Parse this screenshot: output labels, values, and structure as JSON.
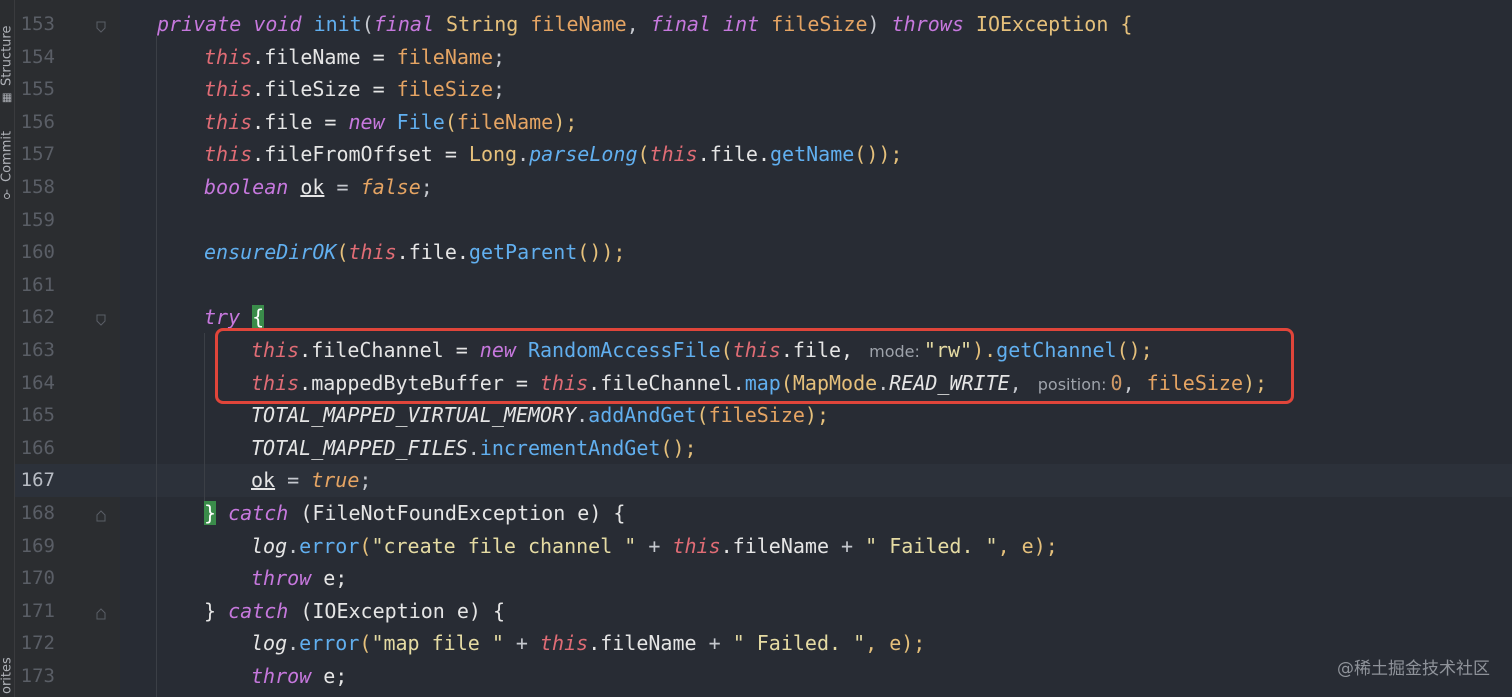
{
  "tool_windows": {
    "structure": "Structure",
    "commit": "Commit",
    "favorites": "orites"
  },
  "current_line": "167",
  "lines": [
    {
      "n": "153"
    },
    {
      "n": "154"
    },
    {
      "n": "155"
    },
    {
      "n": "156"
    },
    {
      "n": "157"
    },
    {
      "n": "158"
    },
    {
      "n": "159"
    },
    {
      "n": "160"
    },
    {
      "n": "161"
    },
    {
      "n": "162"
    },
    {
      "n": "163"
    },
    {
      "n": "164"
    },
    {
      "n": "165"
    },
    {
      "n": "166"
    },
    {
      "n": "167"
    },
    {
      "n": "168"
    },
    {
      "n": "169"
    },
    {
      "n": "170"
    },
    {
      "n": "171"
    },
    {
      "n": "172"
    },
    {
      "n": "173"
    }
  ],
  "code": {
    "l153": {
      "kw1": "private",
      "kw2": "void",
      "name": "init",
      "p1": "(",
      "kw3": "final",
      "t1": "String",
      "a1": "fileName",
      "c1": ", ",
      "kw4": "final",
      "kw5": "int",
      "a2": "fileSize",
      "p2": ") ",
      "kw6": "throws",
      "t2": "IOException",
      "p3": " {"
    },
    "l154": {
      "this": "this",
      "rest": ".fileName = ",
      "v": "fileName",
      "end": ";"
    },
    "l155": {
      "this": "this",
      "rest": ".fileSize = ",
      "v": "fileSize",
      "end": ";"
    },
    "l156": {
      "this": "this",
      "rest": ".file = ",
      "kw": "new",
      "cls": "File",
      "p1": "(",
      "v": "fileName",
      "end": ");"
    },
    "l157": {
      "this": "this",
      "rest": ".fileFromOffset = ",
      "cls": "Long",
      "dot": ".",
      "m": "parseLong",
      "p1": "(",
      "this2": "this",
      "mid": ".file.",
      "m2": "getName",
      "end": "());"
    },
    "l158": {
      "kw": "boolean",
      "var": "ok",
      "eq": " = ",
      "val": "false",
      "end": ";"
    },
    "l160": {
      "m": "ensureDirOK",
      "p1": "(",
      "this": "this",
      "mid": ".file.",
      "m2": "getParent",
      "end": "());"
    },
    "l162": {
      "kw": "try",
      "brace": "{"
    },
    "l163": {
      "this": "this",
      "rest": ".fileChannel = ",
      "kw": "new",
      "cls": "RandomAccessFile",
      "p1": "(",
      "this2": "this",
      "mid": ".file,",
      "hint": "mode:",
      "str": "\"rw\"",
      "p2": ").",
      "m": "getChannel",
      "end": "();"
    },
    "l164": {
      "this": "this",
      "rest": ".mappedByteBuffer = ",
      "this2": "this",
      "mid": ".fileChannel.",
      "m": "map",
      "p1": "(",
      "cls": "MapMode",
      "dot": ".",
      "const": "READ_WRITE",
      "comma": ",",
      "hint": "position:",
      "num": "0",
      "c2": ", ",
      "v": "fileSize",
      "end": ");"
    },
    "l165": {
      "const": "TOTAL_MAPPED_VIRTUAL_MEMORY",
      "dot": ".",
      "m": "addAndGet",
      "p1": "(",
      "v": "fileSize",
      "end": ");"
    },
    "l166": {
      "const": "TOTAL_MAPPED_FILES",
      "dot": ".",
      "m": "incrementAndGet",
      "end": "();"
    },
    "l167": {
      "var": "ok",
      "eq": " = ",
      "val": "true",
      "end": ";"
    },
    "l168": {
      "brace": "}",
      "kw": "catch",
      "rest": " (FileNotFoundException e) {"
    },
    "l169": {
      "obj": "log",
      "dot": ".",
      "m": "error",
      "p1": "(",
      "s1": "\"create file channel \"",
      "plus1": " + ",
      "this": "this",
      "mid": ".fileName",
      "plus2": " + ",
      "s2": "\" Failed. \"",
      "end": ", e);"
    },
    "l170": {
      "kw": "throw",
      "rest": " e;"
    },
    "l171": {
      "brace": "} ",
      "kw": "catch",
      "rest": " (IOException e) {"
    },
    "l172": {
      "obj": "log",
      "dot": ".",
      "m": "error",
      "p1": "(",
      "s1": "\"map file \"",
      "plus1": " + ",
      "this": "this",
      "mid": ".fileName",
      "plus2": " + ",
      "s2": "\" Failed. \"",
      "end": ", e);"
    },
    "l173": {
      "kw": "throw",
      "rest": " e;"
    }
  },
  "watermark": "@稀土掘金技术社区",
  "colors": {
    "highlight_box": "#e0453a",
    "brace_match": "#3a8c4a"
  }
}
